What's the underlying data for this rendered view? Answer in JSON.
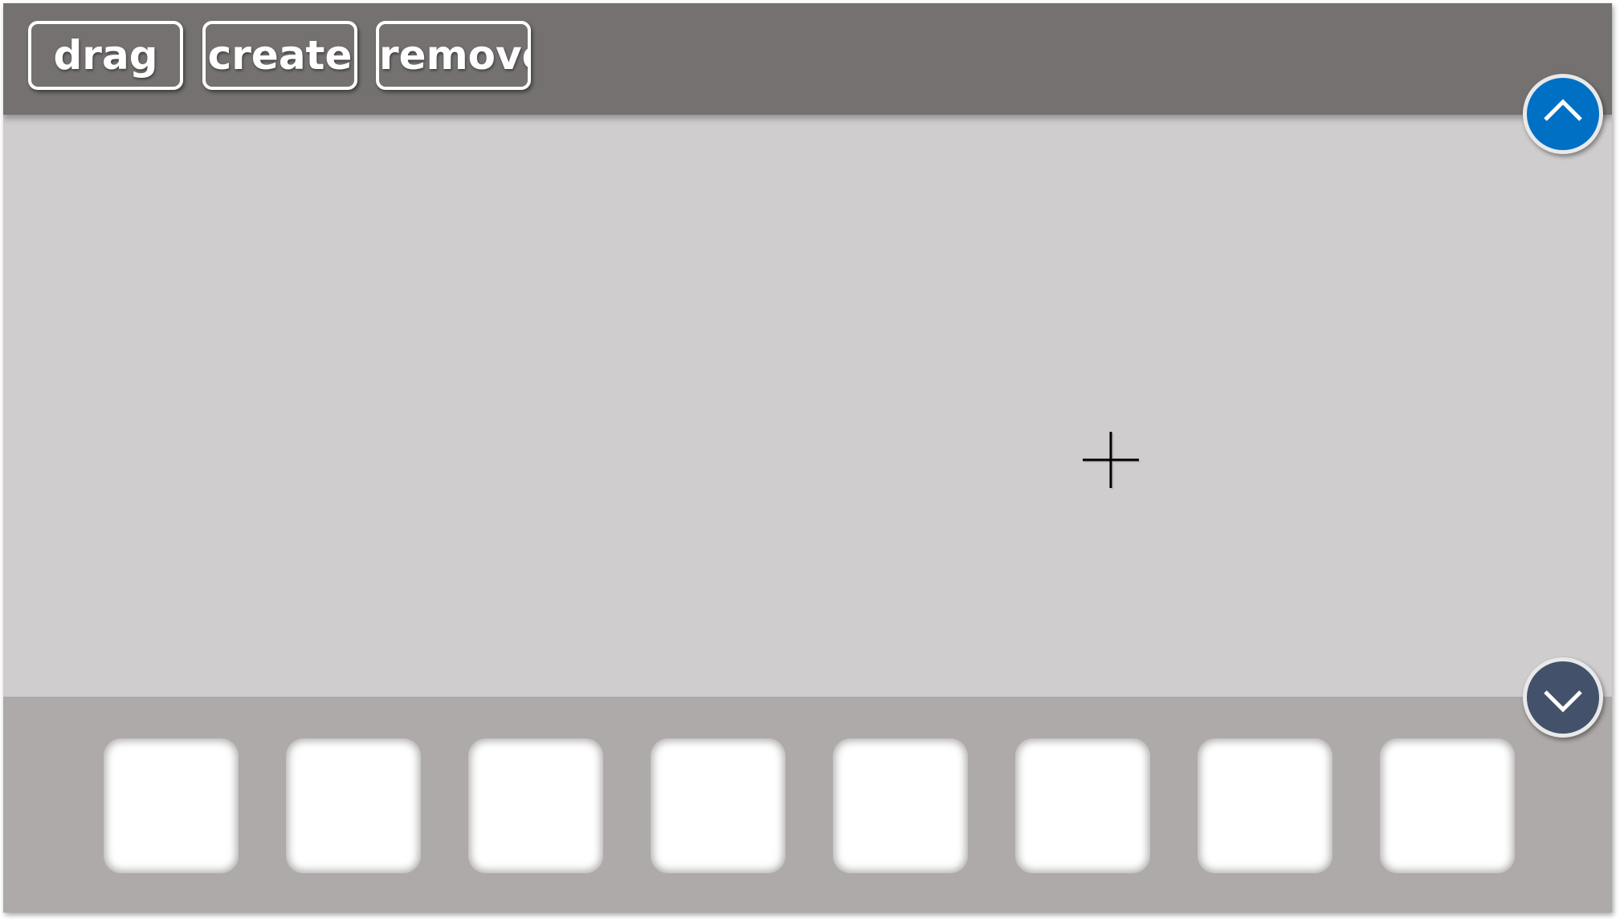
{
  "toolbar": {
    "buttons": [
      {
        "label": "drag"
      },
      {
        "label": "create"
      },
      {
        "label": "remove"
      }
    ]
  },
  "canvas": {
    "cursor": "crosshair-icon"
  },
  "tray": {
    "slot_count": 8
  },
  "scroll": {
    "up_icon": "chevron-up-icon",
    "down_icon": "chevron-down-icon",
    "up_color": "#0070c4",
    "down_color": "#43526a"
  },
  "colors": {
    "toolbar": "#747170",
    "canvas": "#cfcdce",
    "tray": "#aeaaa9"
  }
}
